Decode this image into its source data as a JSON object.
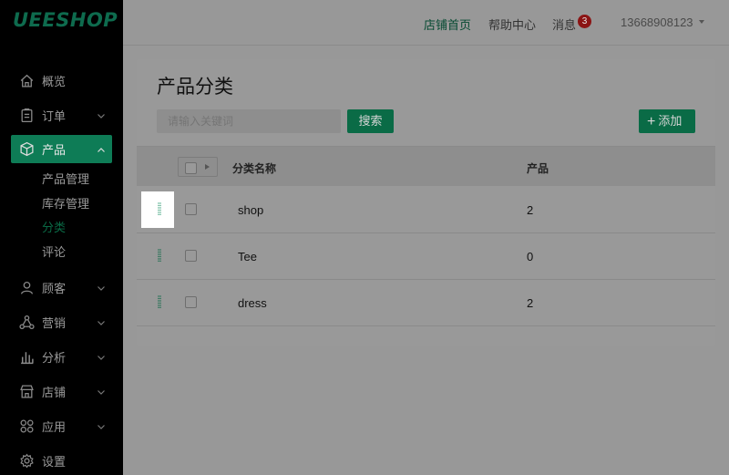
{
  "app": {
    "logo": "UEESHOP"
  },
  "sidebar": {
    "items": [
      {
        "label": "概览",
        "icon": "home-icon"
      },
      {
        "label": "订单",
        "icon": "clipboard-icon",
        "expandable": true
      },
      {
        "label": "产品",
        "icon": "cube-icon",
        "expandable": true,
        "active": true,
        "sub": [
          {
            "label": "产品管理"
          },
          {
            "label": "库存管理"
          },
          {
            "label": "分类",
            "current": true
          },
          {
            "label": "评论"
          }
        ]
      },
      {
        "label": "顾客",
        "icon": "user-icon",
        "expandable": true
      },
      {
        "label": "营销",
        "icon": "network-icon",
        "expandable": true
      },
      {
        "label": "分析",
        "icon": "bar-chart-icon",
        "expandable": true
      },
      {
        "label": "店铺",
        "icon": "store-icon",
        "expandable": true
      },
      {
        "label": "应用",
        "icon": "apps-icon",
        "expandable": true
      },
      {
        "label": "设置",
        "icon": "gear-icon"
      }
    ]
  },
  "topbar": {
    "home": "店铺首页",
    "help": "帮助中心",
    "messages": "消息",
    "message_count": "3",
    "user": "13668908123"
  },
  "page": {
    "title": "产品分类",
    "search_placeholder": "请输入关键词",
    "search_button": "搜索",
    "add_button": "添加"
  },
  "table": {
    "columns": [
      "分类名称",
      "产品"
    ],
    "rows": [
      {
        "name": "shop",
        "count": "2"
      },
      {
        "name": "Tee",
        "count": "0"
      },
      {
        "name": "dress",
        "count": "2"
      }
    ]
  },
  "colors": {
    "accent": "#0e7c56",
    "badge": "#8b1414",
    "sidebar": "#000000"
  }
}
